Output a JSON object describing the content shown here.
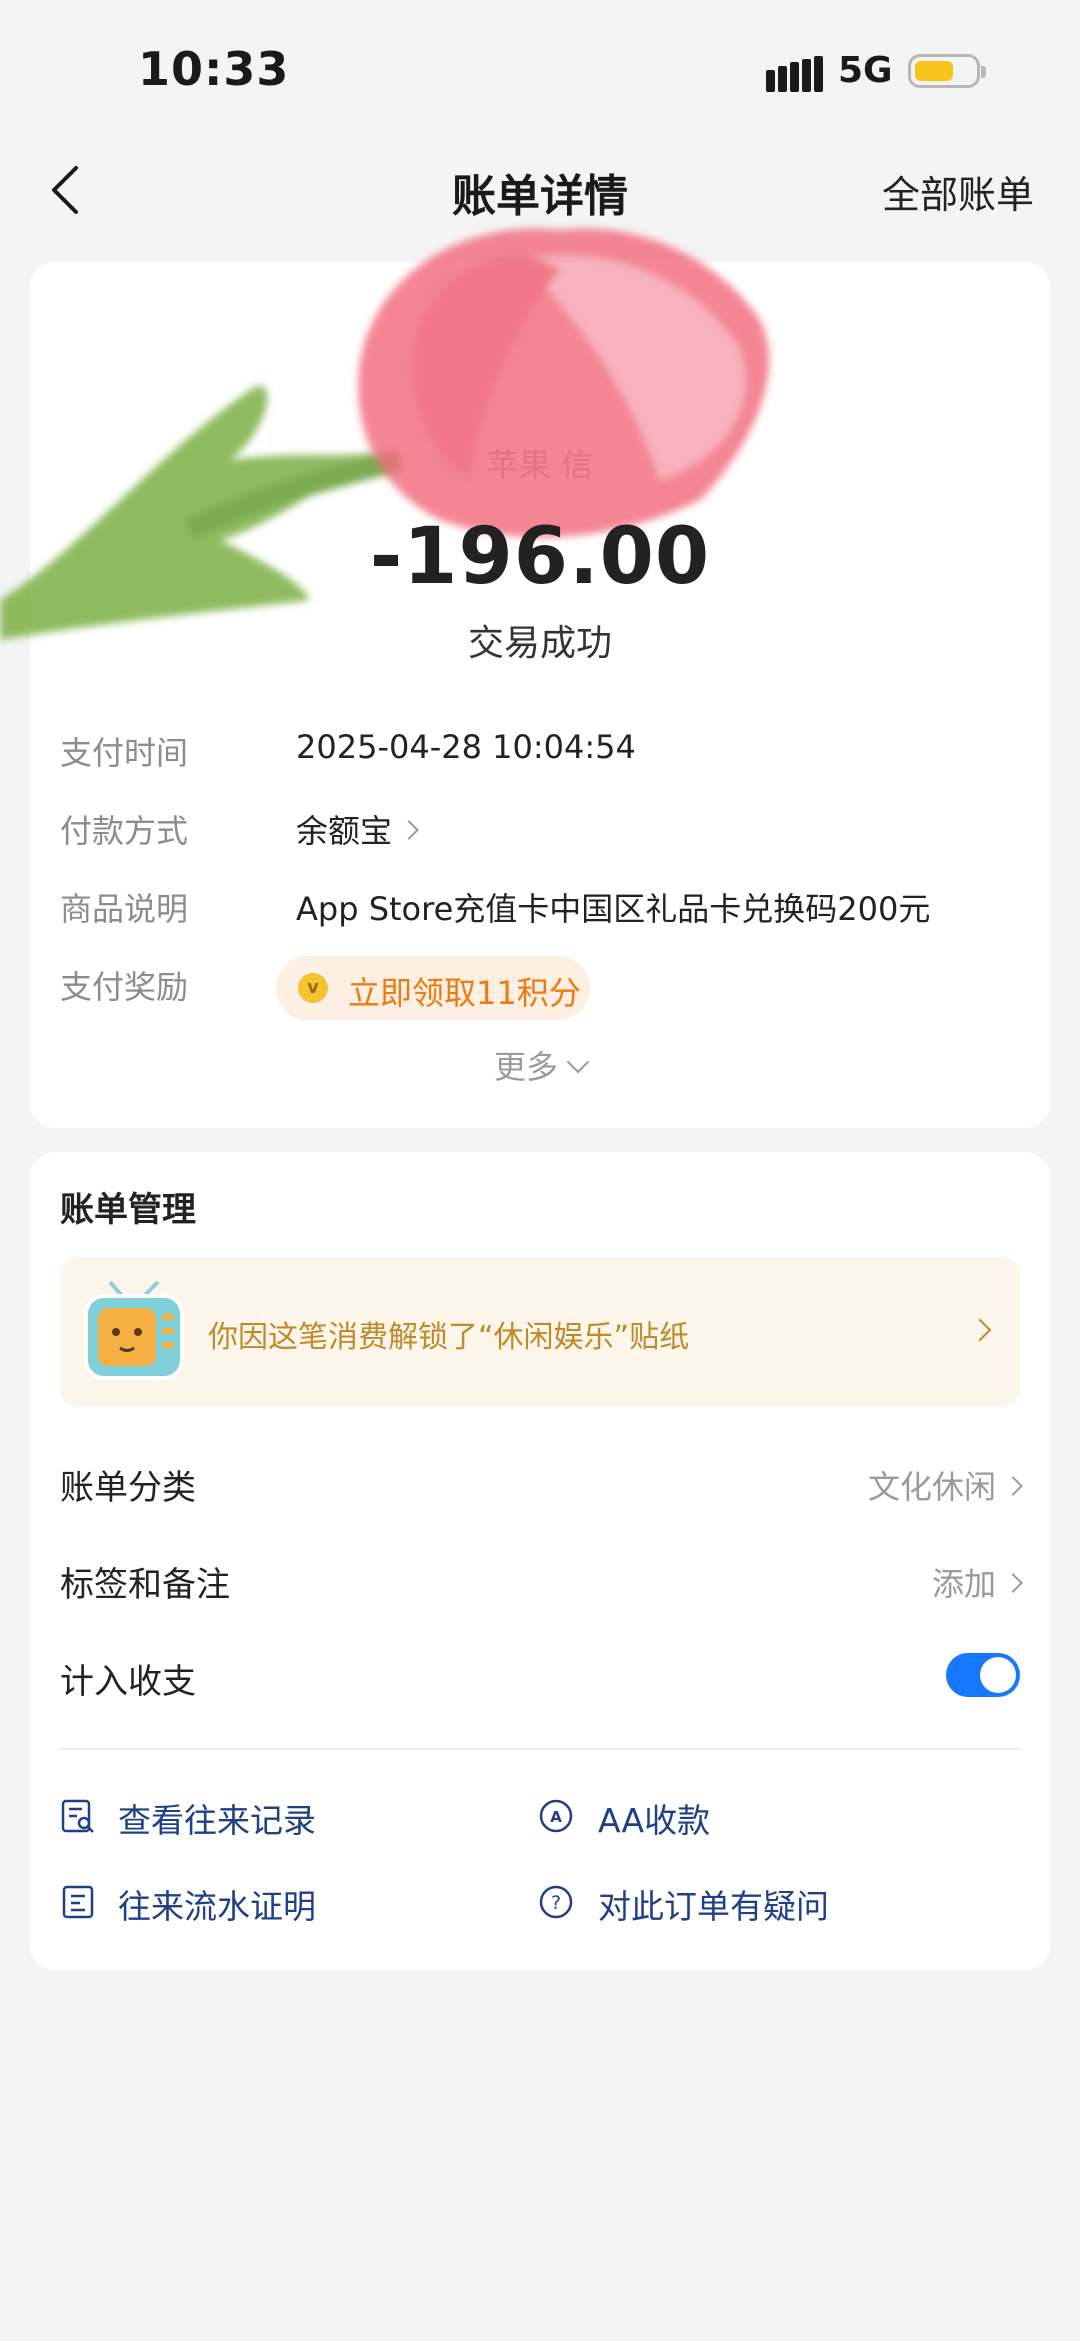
{
  "status_bar": {
    "time": "10:33",
    "network": "5G"
  },
  "nav": {
    "title": "账单详情",
    "right": "全部账单"
  },
  "bill": {
    "merchant": "苹果 信",
    "amount": "-196.00",
    "status": "交易成功",
    "rows": [
      {
        "label": "支付时间",
        "value": "2025-04-28 10:04:54"
      },
      {
        "label": "付款方式",
        "value": "余额宝"
      },
      {
        "label": "商品说明",
        "value": "App Store充值卡中国区礼品卡兑换码200元"
      },
      {
        "label": "支付奖励",
        "value": "立即领取11积分"
      }
    ],
    "more": "更多"
  },
  "manage": {
    "title": "账单管理",
    "sticker_text": "你因这笔消费解锁了“休闲娱乐”贴纸",
    "items": [
      {
        "label": "账单分类",
        "value": "文化休闲"
      },
      {
        "label": "标签和备注",
        "value": "添加"
      },
      {
        "label": "计入收支",
        "toggle_on": true
      }
    ],
    "actions": [
      {
        "label": "查看往来记录",
        "icon": "record-search-icon"
      },
      {
        "label": "AA收款",
        "icon": "aa-icon"
      },
      {
        "label": "往来流水证明",
        "icon": "document-icon"
      },
      {
        "label": "对此订单有疑问",
        "icon": "question-icon"
      }
    ]
  },
  "colors": {
    "accent": "#1677ff",
    "link": "#1f3f86",
    "reward": "#ef7a12",
    "sticker_text": "#c08a2a"
  }
}
